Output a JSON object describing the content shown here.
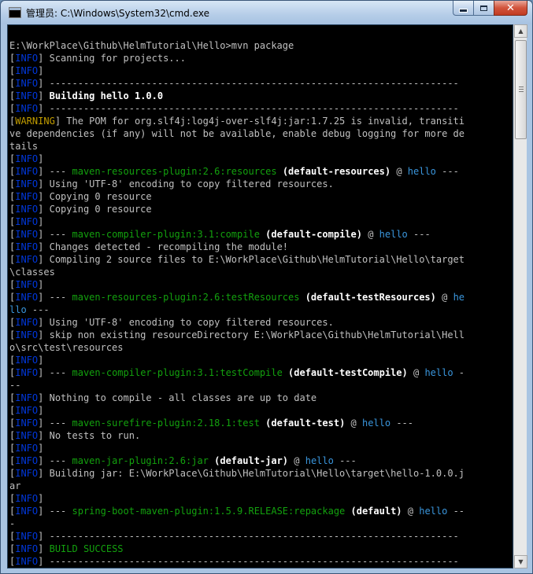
{
  "window": {
    "title": "管理员: C:\\Windows\\System32\\cmd.exe",
    "icon_text": "C:\\"
  },
  "console": {
    "lines": [
      [
        {
          "t": "E:\\WorkPlace\\Github\\HelmTutorial\\Hello>mvn package",
          "c": "w"
        }
      ],
      [
        {
          "t": "[",
          "c": "w"
        },
        {
          "t": "INFO",
          "c": "b"
        },
        {
          "t": "] Scanning for projects...",
          "c": "w"
        }
      ],
      [
        {
          "t": "[",
          "c": "w"
        },
        {
          "t": "INFO",
          "c": "b"
        },
        {
          "t": "]",
          "c": "w"
        }
      ],
      [
        {
          "t": "[",
          "c": "w"
        },
        {
          "t": "INFO",
          "c": "b"
        },
        {
          "t": "] ------------------------------------------------------------------------",
          "c": "w"
        }
      ],
      [
        {
          "t": "[",
          "c": "w"
        },
        {
          "t": "INFO",
          "c": "b"
        },
        {
          "t": "] ",
          "c": "w"
        },
        {
          "t": "Building hello 1.0.0",
          "c": "bw"
        }
      ],
      [
        {
          "t": "[",
          "c": "w"
        },
        {
          "t": "INFO",
          "c": "b"
        },
        {
          "t": "] ------------------------------------------------------------------------",
          "c": "w"
        }
      ],
      [
        {
          "t": "[",
          "c": "w"
        },
        {
          "t": "WARNING",
          "c": "y"
        },
        {
          "t": "] The POM for org.slf4j:log4j-over-slf4j:jar:1.7.25 is invalid, transiti",
          "c": "w"
        }
      ],
      [
        {
          "t": "ve dependencies (if any) will not be available, enable debug logging for more de",
          "c": "w"
        }
      ],
      [
        {
          "t": "tails",
          "c": "w"
        }
      ],
      [
        {
          "t": "[",
          "c": "w"
        },
        {
          "t": "INFO",
          "c": "b"
        },
        {
          "t": "]",
          "c": "w"
        }
      ],
      [
        {
          "t": "[",
          "c": "w"
        },
        {
          "t": "INFO",
          "c": "b"
        },
        {
          "t": "] --- ",
          "c": "w"
        },
        {
          "t": "maven-resources-plugin:2.6:resources",
          "c": "g"
        },
        {
          "t": " (default-resources)",
          "c": "bw"
        },
        {
          "t": " @ ",
          "c": "w"
        },
        {
          "t": "hello",
          "c": "c"
        },
        {
          "t": " ---",
          "c": "w"
        }
      ],
      [
        {
          "t": "[",
          "c": "w"
        },
        {
          "t": "INFO",
          "c": "b"
        },
        {
          "t": "] Using 'UTF-8' encoding to copy filtered resources.",
          "c": "w"
        }
      ],
      [
        {
          "t": "[",
          "c": "w"
        },
        {
          "t": "INFO",
          "c": "b"
        },
        {
          "t": "] Copying 0 resource",
          "c": "w"
        }
      ],
      [
        {
          "t": "[",
          "c": "w"
        },
        {
          "t": "INFO",
          "c": "b"
        },
        {
          "t": "] Copying 0 resource",
          "c": "w"
        }
      ],
      [
        {
          "t": "[",
          "c": "w"
        },
        {
          "t": "INFO",
          "c": "b"
        },
        {
          "t": "]",
          "c": "w"
        }
      ],
      [
        {
          "t": "[",
          "c": "w"
        },
        {
          "t": "INFO",
          "c": "b"
        },
        {
          "t": "] --- ",
          "c": "w"
        },
        {
          "t": "maven-compiler-plugin:3.1:compile",
          "c": "g"
        },
        {
          "t": " (default-compile)",
          "c": "bw"
        },
        {
          "t": " @ ",
          "c": "w"
        },
        {
          "t": "hello",
          "c": "c"
        },
        {
          "t": " ---",
          "c": "w"
        }
      ],
      [
        {
          "t": "[",
          "c": "w"
        },
        {
          "t": "INFO",
          "c": "b"
        },
        {
          "t": "] Changes detected - recompiling the module!",
          "c": "w"
        }
      ],
      [
        {
          "t": "[",
          "c": "w"
        },
        {
          "t": "INFO",
          "c": "b"
        },
        {
          "t": "] Compiling 2 source files to E:\\WorkPlace\\Github\\HelmTutorial\\Hello\\target",
          "c": "w"
        }
      ],
      [
        {
          "t": "\\classes",
          "c": "w"
        }
      ],
      [
        {
          "t": "[",
          "c": "w"
        },
        {
          "t": "INFO",
          "c": "b"
        },
        {
          "t": "]",
          "c": "w"
        }
      ],
      [
        {
          "t": "[",
          "c": "w"
        },
        {
          "t": "INFO",
          "c": "b"
        },
        {
          "t": "] --- ",
          "c": "w"
        },
        {
          "t": "maven-resources-plugin:2.6:testResources",
          "c": "g"
        },
        {
          "t": " (default-testResources)",
          "c": "bw"
        },
        {
          "t": " @ ",
          "c": "w"
        },
        {
          "t": "he",
          "c": "c"
        }
      ],
      [
        {
          "t": "llo",
          "c": "c"
        },
        {
          "t": " ---",
          "c": "w"
        }
      ],
      [
        {
          "t": "[",
          "c": "w"
        },
        {
          "t": "INFO",
          "c": "b"
        },
        {
          "t": "] Using 'UTF-8' encoding to copy filtered resources.",
          "c": "w"
        }
      ],
      [
        {
          "t": "[",
          "c": "w"
        },
        {
          "t": "INFO",
          "c": "b"
        },
        {
          "t": "] skip non existing resourceDirectory E:\\WorkPlace\\Github\\HelmTutorial\\Hell",
          "c": "w"
        }
      ],
      [
        {
          "t": "o\\src\\test\\resources",
          "c": "w"
        }
      ],
      [
        {
          "t": "[",
          "c": "w"
        },
        {
          "t": "INFO",
          "c": "b"
        },
        {
          "t": "]",
          "c": "w"
        }
      ],
      [
        {
          "t": "[",
          "c": "w"
        },
        {
          "t": "INFO",
          "c": "b"
        },
        {
          "t": "] --- ",
          "c": "w"
        },
        {
          "t": "maven-compiler-plugin:3.1:testCompile",
          "c": "g"
        },
        {
          "t": " (default-testCompile)",
          "c": "bw"
        },
        {
          "t": " @ ",
          "c": "w"
        },
        {
          "t": "hello",
          "c": "c"
        },
        {
          "t": " -",
          "c": "w"
        }
      ],
      [
        {
          "t": "--",
          "c": "w"
        }
      ],
      [
        {
          "t": "[",
          "c": "w"
        },
        {
          "t": "INFO",
          "c": "b"
        },
        {
          "t": "] Nothing to compile - all classes are up to date",
          "c": "w"
        }
      ],
      [
        {
          "t": "[",
          "c": "w"
        },
        {
          "t": "INFO",
          "c": "b"
        },
        {
          "t": "]",
          "c": "w"
        }
      ],
      [
        {
          "t": "[",
          "c": "w"
        },
        {
          "t": "INFO",
          "c": "b"
        },
        {
          "t": "] --- ",
          "c": "w"
        },
        {
          "t": "maven-surefire-plugin:2.18.1:test",
          "c": "g"
        },
        {
          "t": " (default-test)",
          "c": "bw"
        },
        {
          "t": " @ ",
          "c": "w"
        },
        {
          "t": "hello",
          "c": "c"
        },
        {
          "t": " ---",
          "c": "w"
        }
      ],
      [
        {
          "t": "[",
          "c": "w"
        },
        {
          "t": "INFO",
          "c": "b"
        },
        {
          "t": "] No tests to run.",
          "c": "w"
        }
      ],
      [
        {
          "t": "[",
          "c": "w"
        },
        {
          "t": "INFO",
          "c": "b"
        },
        {
          "t": "]",
          "c": "w"
        }
      ],
      [
        {
          "t": "[",
          "c": "w"
        },
        {
          "t": "INFO",
          "c": "b"
        },
        {
          "t": "] --- ",
          "c": "w"
        },
        {
          "t": "maven-jar-plugin:2.6:jar",
          "c": "g"
        },
        {
          "t": " (default-jar)",
          "c": "bw"
        },
        {
          "t": " @ ",
          "c": "w"
        },
        {
          "t": "hello",
          "c": "c"
        },
        {
          "t": " ---",
          "c": "w"
        }
      ],
      [
        {
          "t": "[",
          "c": "w"
        },
        {
          "t": "INFO",
          "c": "b"
        },
        {
          "t": "] Building jar: E:\\WorkPlace\\Github\\HelmTutorial\\Hello\\target\\hello-1.0.0.j",
          "c": "w"
        }
      ],
      [
        {
          "t": "ar",
          "c": "w"
        }
      ],
      [
        {
          "t": "[",
          "c": "w"
        },
        {
          "t": "INFO",
          "c": "b"
        },
        {
          "t": "]",
          "c": "w"
        }
      ],
      [
        {
          "t": "[",
          "c": "w"
        },
        {
          "t": "INFO",
          "c": "b"
        },
        {
          "t": "] --- ",
          "c": "w"
        },
        {
          "t": "spring-boot-maven-plugin:1.5.9.RELEASE:repackage",
          "c": "g"
        },
        {
          "t": " (default)",
          "c": "bw"
        },
        {
          "t": " @ ",
          "c": "w"
        },
        {
          "t": "hello",
          "c": "c"
        },
        {
          "t": " --",
          "c": "w"
        }
      ],
      [
        {
          "t": "-",
          "c": "w"
        }
      ],
      [
        {
          "t": "[",
          "c": "w"
        },
        {
          "t": "INFO",
          "c": "b"
        },
        {
          "t": "] ------------------------------------------------------------------------",
          "c": "w"
        }
      ],
      [
        {
          "t": "[",
          "c": "w"
        },
        {
          "t": "INFO",
          "c": "b"
        },
        {
          "t": "] ",
          "c": "w"
        },
        {
          "t": "BUILD SUCCESS",
          "c": "g"
        }
      ],
      [
        {
          "t": "[",
          "c": "w"
        },
        {
          "t": "INFO",
          "c": "b"
        },
        {
          "t": "] ------------------------------------------------------------------------",
          "c": "w"
        }
      ]
    ]
  },
  "colors": {
    "info": "#0037da",
    "warning": "#c19c00",
    "plugin": "#13a10e",
    "project": "#3a96dd",
    "text": "#c0c0c0",
    "background": "#000000"
  },
  "scrollbar": {
    "up_icon": "triangle-up-icon",
    "down_icon": "triangle-down-icon",
    "thumb_position": 0.03
  }
}
